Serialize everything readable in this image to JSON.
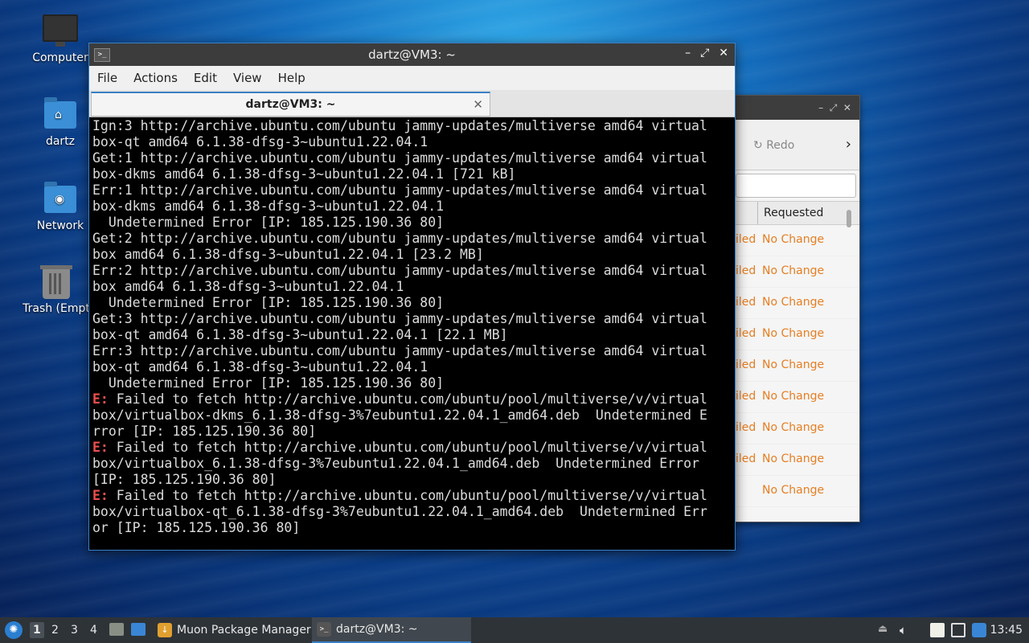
{
  "desktop": {
    "icons": [
      {
        "label": "Computer",
        "icon": "computer-icon"
      },
      {
        "label": "dartz",
        "icon": "home-folder-icon"
      },
      {
        "label": "Network",
        "icon": "network-folder-icon"
      },
      {
        "label": "Trash (Empt",
        "icon": "trash-icon"
      }
    ]
  },
  "background_window": {
    "redo_label": "Redo",
    "column_header": "Requested",
    "rows": [
      {
        "c1": "iled",
        "c2": "No Change"
      },
      {
        "c1": "iled",
        "c2": "No Change"
      },
      {
        "c1": "iled",
        "c2": "No Change"
      },
      {
        "c1": "iled",
        "c2": "No Change"
      },
      {
        "c1": "iled",
        "c2": "No Change"
      },
      {
        "c1": "iled",
        "c2": "No Change"
      },
      {
        "c1": "iled",
        "c2": "No Change"
      },
      {
        "c1": "iled",
        "c2": "No Change"
      },
      {
        "c1": "",
        "c2": "No Change"
      }
    ],
    "status_color": "#e67e22"
  },
  "terminal": {
    "title": "dartz@VM3: ~",
    "menu": [
      "File",
      "Actions",
      "Edit",
      "View",
      "Help"
    ],
    "tab_label": "dartz@VM3: ~",
    "lines": [
      {
        "t": "Ign:3 http://archive.ubuntu.com/ubuntu jammy-updates/multiverse amd64 virtual"
      },
      {
        "t": "box-qt amd64 6.1.38-dfsg-3~ubuntu1.22.04.1"
      },
      {
        "t": "Get:1 http://archive.ubuntu.com/ubuntu jammy-updates/multiverse amd64 virtual"
      },
      {
        "t": "box-dkms amd64 6.1.38-dfsg-3~ubuntu1.22.04.1 [721 kB]"
      },
      {
        "t": "Err:1 http://archive.ubuntu.com/ubuntu jammy-updates/multiverse amd64 virtual"
      },
      {
        "t": "box-dkms amd64 6.1.38-dfsg-3~ubuntu1.22.04.1"
      },
      {
        "t": "  Undetermined Error [IP: 185.125.190.36 80]"
      },
      {
        "t": "Get:2 http://archive.ubuntu.com/ubuntu jammy-updates/multiverse amd64 virtual"
      },
      {
        "t": "box amd64 6.1.38-dfsg-3~ubuntu1.22.04.1 [23.2 MB]"
      },
      {
        "t": "Err:2 http://archive.ubuntu.com/ubuntu jammy-updates/multiverse amd64 virtual"
      },
      {
        "t": "box amd64 6.1.38-dfsg-3~ubuntu1.22.04.1"
      },
      {
        "t": "  Undetermined Error [IP: 185.125.190.36 80]"
      },
      {
        "t": "Get:3 http://archive.ubuntu.com/ubuntu jammy-updates/multiverse amd64 virtual"
      },
      {
        "t": "box-qt amd64 6.1.38-dfsg-3~ubuntu1.22.04.1 [22.1 MB]"
      },
      {
        "t": "Err:3 http://archive.ubuntu.com/ubuntu jammy-updates/multiverse amd64 virtual"
      },
      {
        "t": "box-qt amd64 6.1.38-dfsg-3~ubuntu1.22.04.1"
      },
      {
        "t": "  Undetermined Error [IP: 185.125.190.36 80]"
      },
      {
        "p": "E:",
        "t": " Failed to fetch http://archive.ubuntu.com/ubuntu/pool/multiverse/v/virtual"
      },
      {
        "t": "box/virtualbox-dkms_6.1.38-dfsg-3%7eubuntu1.22.04.1_amd64.deb  Undetermined E"
      },
      {
        "t": "rror [IP: 185.125.190.36 80]"
      },
      {
        "p": "E:",
        "t": " Failed to fetch http://archive.ubuntu.com/ubuntu/pool/multiverse/v/virtual"
      },
      {
        "t": "box/virtualbox_6.1.38-dfsg-3%7eubuntu1.22.04.1_amd64.deb  Undetermined Error"
      },
      {
        "t": "[IP: 185.125.190.36 80]"
      },
      {
        "p": "E:",
        "t": " Failed to fetch http://archive.ubuntu.com/ubuntu/pool/multiverse/v/virtual"
      },
      {
        "t": "box/virtualbox-qt_6.1.38-dfsg-3%7eubuntu1.22.04.1_amd64.deb  Undetermined Err"
      },
      {
        "t": "or [IP: 185.125.190.36 80]"
      }
    ],
    "error_color": "#ef4f4f"
  },
  "taskbar": {
    "workspaces": [
      "1",
      "2",
      "3",
      "4"
    ],
    "active_workspace": "1",
    "tasks": [
      {
        "label": "Muon Package Manager",
        "icon": "muon-icon"
      },
      {
        "label": "dartz@VM3: ~",
        "icon": "terminal-icon"
      }
    ],
    "clock": "13:45"
  }
}
